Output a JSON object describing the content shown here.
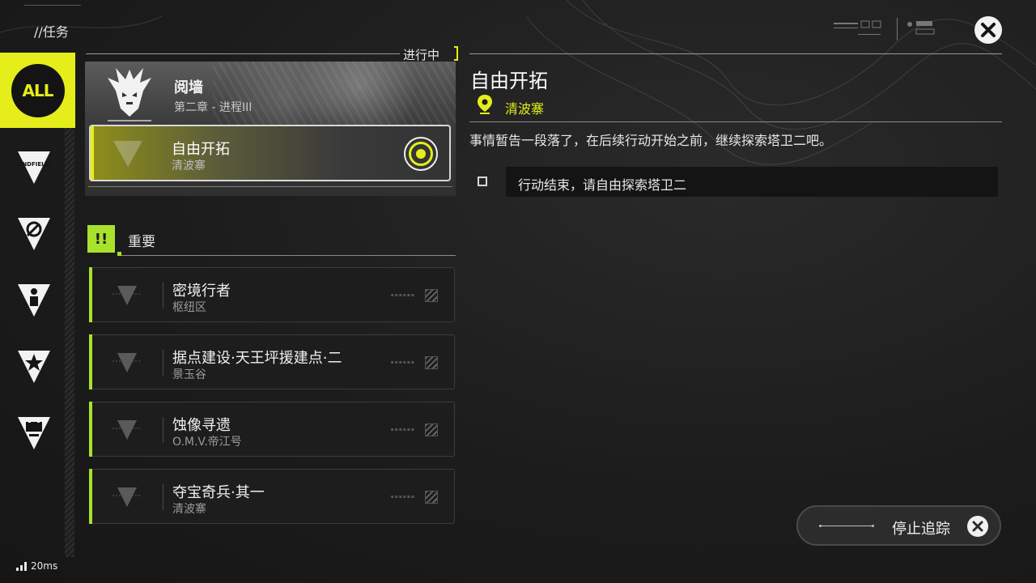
{
  "header": {
    "breadcrumb": "//任务",
    "close_icon": "close-icon"
  },
  "sidebar": {
    "all_label": "ALL",
    "all_color": "#e5ee1a",
    "tabs": [
      {
        "name": "endfield",
        "icon": "endfield-icon",
        "label": "ENDFIELD"
      },
      {
        "name": "explore",
        "icon": "explore-icon"
      },
      {
        "name": "character",
        "icon": "character-icon"
      },
      {
        "name": "star",
        "icon": "star-icon"
      },
      {
        "name": "facility",
        "icon": "facility-icon"
      }
    ]
  },
  "in_progress": {
    "label": "进行中",
    "chapter": {
      "title": "阅墙",
      "subtitle": "第二章 - 进程III"
    },
    "active_quest": {
      "title": "自由开拓",
      "location": "清波寨"
    }
  },
  "important": {
    "badge": "!!",
    "label": "重要",
    "accent": "#a9e22a",
    "quests": [
      {
        "title": "密境行者",
        "location": "枢纽区"
      },
      {
        "title": "据点建设·天王坪援建点·二",
        "location": "景玉谷"
      },
      {
        "title": "蚀像寻遗",
        "location": "O.M.V.帝江号"
      },
      {
        "title": "夺宝奇兵·其一",
        "location": "清波寨"
      }
    ]
  },
  "detail": {
    "title": "自由开拓",
    "location": "清波寨",
    "description": "事情暂告一段落了，在后续行动开始之前，继续探索塔卫二吧。",
    "objectives": [
      {
        "text": "行动结束，请自由探索塔卫二",
        "done": false
      }
    ]
  },
  "footer": {
    "stop_tracking_label": "停止追踪",
    "ping": "20ms"
  }
}
